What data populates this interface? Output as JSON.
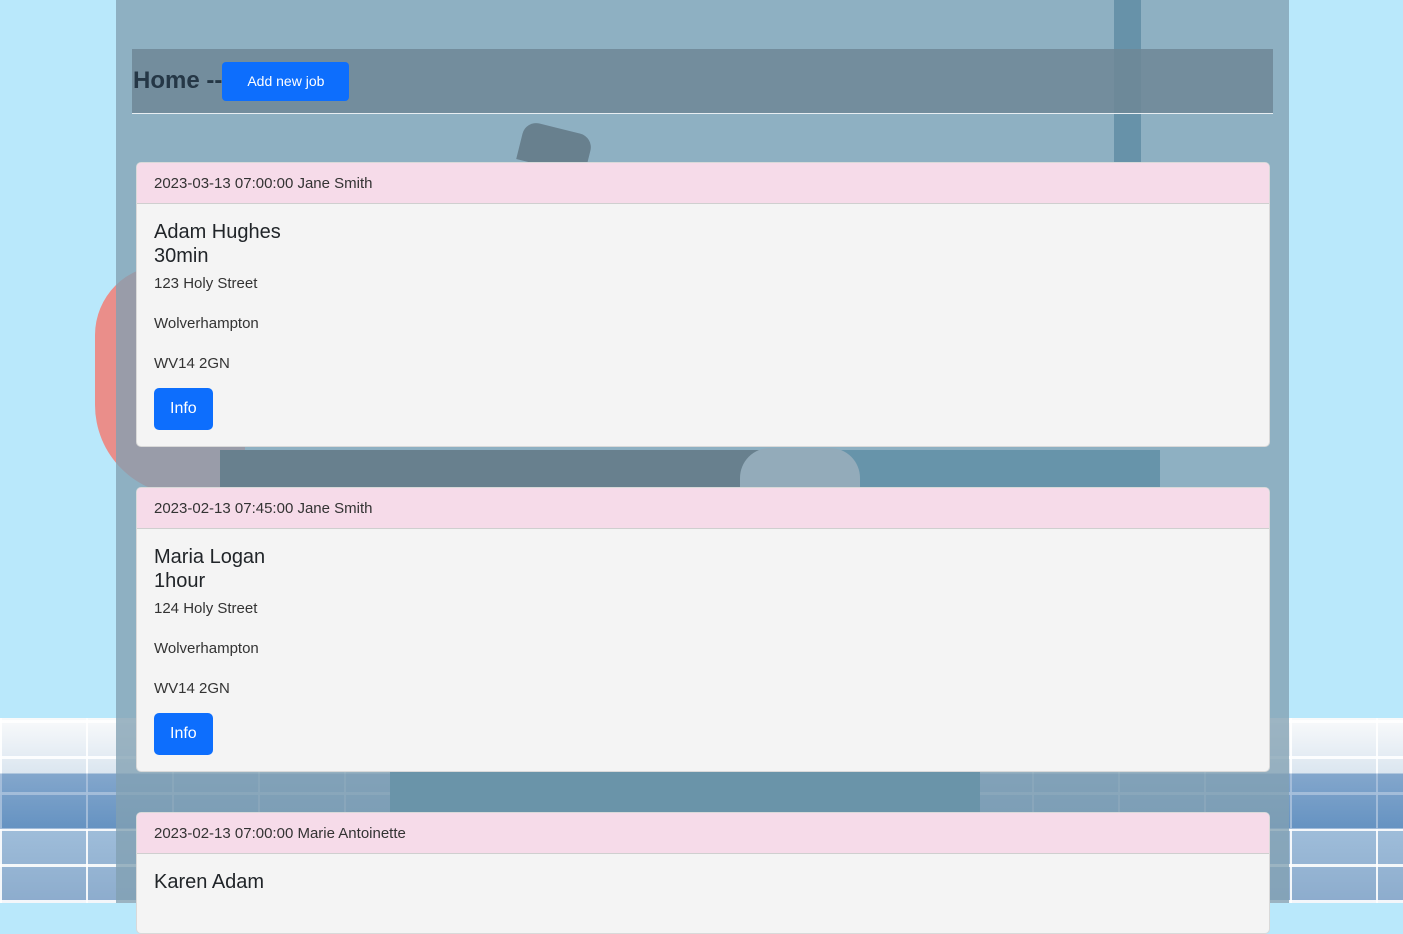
{
  "navbar": {
    "title": "Home --",
    "add_button": "Add new job"
  },
  "jobs": [
    {
      "header": "2023-03-13 07:00:00 Jane Smith",
      "client": "Adam Hughes",
      "duration": "30min",
      "address_line": "123 Holy Street",
      "city": "Wolverhampton",
      "postcode": "WV14 2GN",
      "info_button": "Info"
    },
    {
      "header": "2023-02-13 07:45:00 Jane Smith",
      "client": "Maria Logan",
      "duration": "1hour",
      "address_line": "124 Holy Street",
      "city": "Wolverhampton",
      "postcode": "WV14 2GN",
      "info_button": "Info"
    },
    {
      "header": "2023-02-13 07:00:00 Marie Antoinette",
      "client": "Karen Adam",
      "duration": "",
      "address_line": "",
      "city": "",
      "postcode": "",
      "info_button": ""
    }
  ]
}
